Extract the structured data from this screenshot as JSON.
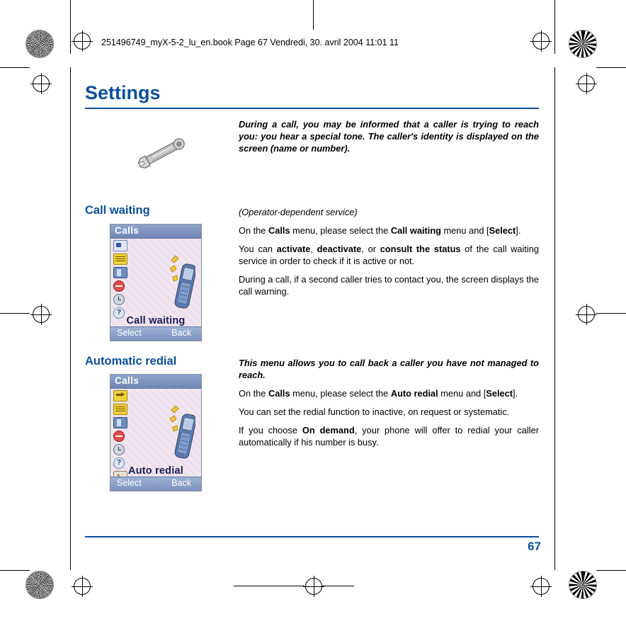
{
  "document": {
    "filestamp": "251496749_myX-5-2_lu_en.book  Page 67  Vendredi, 30. avril 2004  11:01 11",
    "title": "Settings",
    "page_number": "67",
    "accent_color": "#0b4f9e"
  },
  "intro": {
    "text": "During a call, you may be informed that a caller is trying to reach you: you hear a special tone. The caller's identity is displayed on the screen (name or number)."
  },
  "sections": [
    {
      "heading": "Call waiting",
      "paragraphs": [
        {
          "style": "italic",
          "runs": [
            {
              "text": "(Operator-dependent service)",
              "bold": false
            }
          ]
        },
        {
          "style": "normal",
          "runs": [
            {
              "text": "On the ",
              "bold": false
            },
            {
              "text": "Calls",
              "bold": true
            },
            {
              "text": " menu, please select the ",
              "bold": false
            },
            {
              "text": "Call waiting",
              "bold": true
            },
            {
              "text": " menu and [",
              "bold": false
            },
            {
              "text": "Select",
              "bold": true
            },
            {
              "text": "].",
              "bold": false
            }
          ]
        },
        {
          "style": "normal",
          "runs": [
            {
              "text": "You can ",
              "bold": false
            },
            {
              "text": "activate",
              "bold": true
            },
            {
              "text": ", ",
              "bold": false
            },
            {
              "text": "deactivate",
              "bold": true
            },
            {
              "text": ", or ",
              "bold": false
            },
            {
              "text": "consult the status",
              "bold": true
            },
            {
              "text": " of the call waiting service in order to check if it is active or not.",
              "bold": false
            }
          ]
        },
        {
          "style": "normal",
          "runs": [
            {
              "text": "During a call, if a second caller tries to contact you, the screen displays the call warning.",
              "bold": false
            }
          ]
        }
      ],
      "phone": {
        "title": "Calls",
        "caption": "Call waiting",
        "softkey_left": "Select",
        "softkey_right": "Back"
      }
    },
    {
      "heading": "Automatic redial",
      "paragraphs": [
        {
          "style": "italic",
          "runs": [
            {
              "text": "This menu allows you to call back a caller you have not managed to reach.",
              "bold": false
            }
          ]
        },
        {
          "style": "normal",
          "runs": [
            {
              "text": "On the ",
              "bold": false
            },
            {
              "text": "Calls",
              "bold": true
            },
            {
              "text": " menu, please select the ",
              "bold": false
            },
            {
              "text": "Auto redial",
              "bold": true
            },
            {
              "text": " menu and [",
              "bold": false
            },
            {
              "text": "Select",
              "bold": true
            },
            {
              "text": "].",
              "bold": false
            }
          ]
        },
        {
          "style": "normal",
          "runs": [
            {
              "text": "You can set the redial function to inactive, on request or systematic.",
              "bold": false
            }
          ]
        },
        {
          "style": "normal",
          "runs": [
            {
              "text": "If you choose ",
              "bold": false
            },
            {
              "text": "On demand",
              "bold": true
            },
            {
              "text": ", your phone will offer to redial your caller automatically if his number is busy.",
              "bold": false
            }
          ]
        }
      ],
      "phone": {
        "title": "Calls",
        "caption": "Auto redial",
        "softkey_left": "Select",
        "softkey_right": "Back"
      }
    }
  ],
  "icons": {
    "wrench": "wrench-icon"
  }
}
